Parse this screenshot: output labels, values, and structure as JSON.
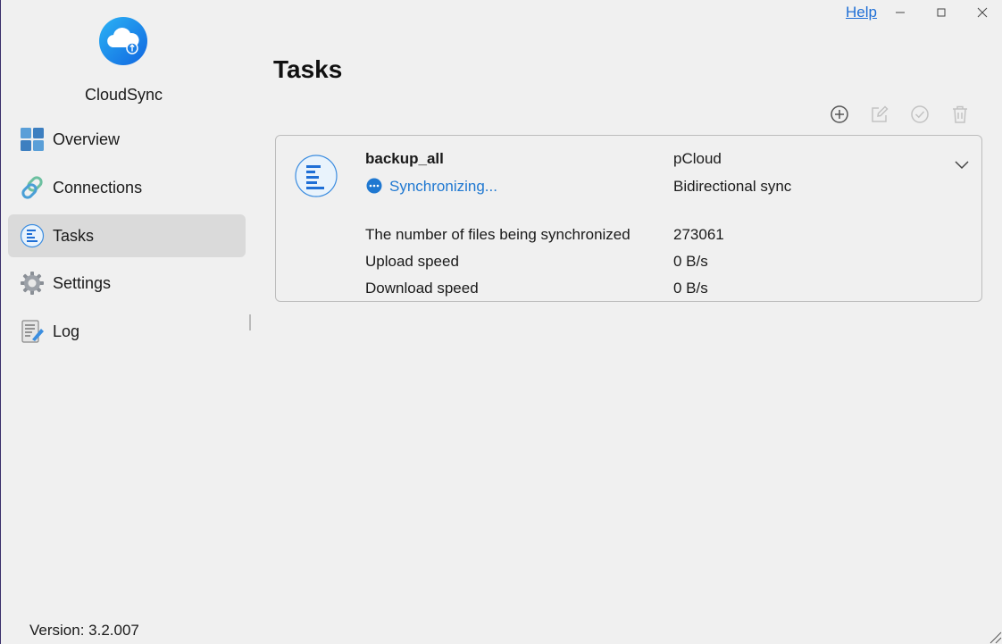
{
  "titlebar": {
    "help_label": "Help",
    "minimize_glyph": "–",
    "maximize_glyph": "☐",
    "close_glyph": "✕"
  },
  "app": {
    "name": "CloudSync",
    "logo_icon": "cloud-sync-icon",
    "version": "Version: 3.2.007",
    "accent": "#1f78d1"
  },
  "sidebar": {
    "items": [
      {
        "label": "Overview",
        "icon": "overview-grid-icon",
        "active": false
      },
      {
        "label": "Connections",
        "icon": "link-icon",
        "active": false
      },
      {
        "label": "Tasks",
        "icon": "tasks-list-icon",
        "active": true
      },
      {
        "label": "Settings",
        "icon": "gear-icon",
        "active": false
      },
      {
        "label": "Log",
        "icon": "log-edit-icon",
        "active": false
      }
    ]
  },
  "main": {
    "title": "Tasks",
    "toolbar": [
      {
        "name": "add",
        "icon": "add-circle-icon",
        "enabled": true
      },
      {
        "name": "edit",
        "icon": "edit-icon",
        "enabled": false
      },
      {
        "name": "verify",
        "icon": "check-circle-icon",
        "enabled": false
      },
      {
        "name": "delete",
        "icon": "trash-icon",
        "enabled": false
      }
    ],
    "task": {
      "name": "backup_all",
      "status": "Synchronizing...",
      "provider": "pCloud",
      "direction": "Bidirectional sync",
      "stats": [
        {
          "label": "The number of files being synchronized",
          "value": "273061"
        },
        {
          "label": "Upload speed",
          "value": "0 B/s"
        },
        {
          "label": "Download speed",
          "value": "0 B/s"
        }
      ]
    }
  }
}
